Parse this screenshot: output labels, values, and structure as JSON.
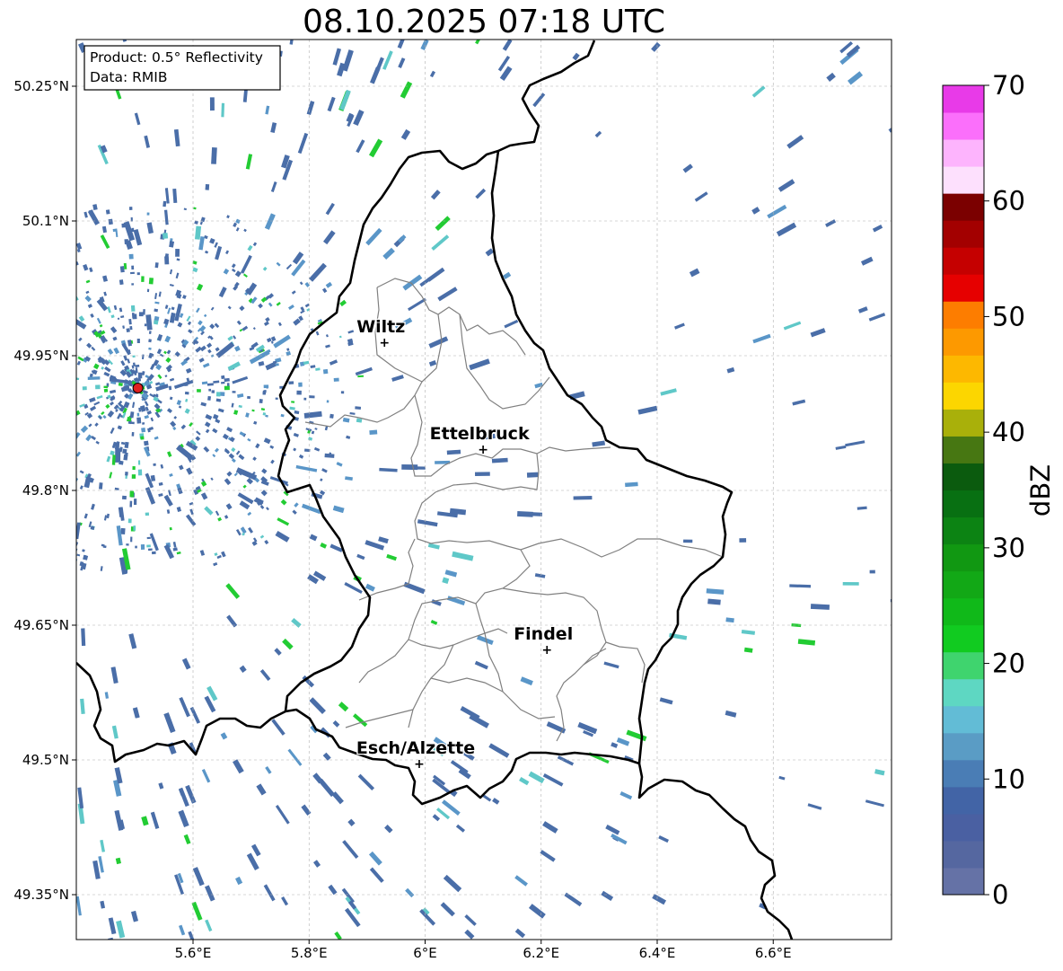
{
  "title": "08.10.2025 07:18 UTC",
  "info_box": {
    "product": "Product: 0.5° Reflectivity",
    "data": "Data: RMIB"
  },
  "axes": {
    "lon_ticks": [
      {
        "value": 5.6,
        "label": "5.6°E"
      },
      {
        "value": 5.8,
        "label": "5.8°E"
      },
      {
        "value": 6.0,
        "label": "6°E"
      },
      {
        "value": 6.2,
        "label": "6.2°E"
      },
      {
        "value": 6.4,
        "label": "6.4°E"
      },
      {
        "value": 6.6,
        "label": "6.6°E"
      }
    ],
    "lat_ticks": [
      {
        "value": 50.25,
        "label": "50.25°N"
      },
      {
        "value": 50.1,
        "label": "50.1°N"
      },
      {
        "value": 49.95,
        "label": "49.95°N"
      },
      {
        "value": 49.8,
        "label": "49.8°N"
      },
      {
        "value": 49.65,
        "label": "49.65°N"
      },
      {
        "value": 49.5,
        "label": "49.5°N"
      },
      {
        "value": 49.35,
        "label": "49.35°N"
      }
    ]
  },
  "places": [
    {
      "name": "Wiltz",
      "lon": 5.93,
      "lat": 49.965
    },
    {
      "name": "Ettelbruck",
      "lon": 6.1,
      "lat": 49.846
    },
    {
      "name": "Findel",
      "lon": 6.21,
      "lat": 49.623
    },
    {
      "name": "Esch/Alzette",
      "lon": 5.99,
      "lat": 49.496
    }
  ],
  "radar_site": {
    "lon": 5.505,
    "lat": 49.914
  },
  "colorbar": {
    "label": "dBZ",
    "ticks": [
      {
        "value": 0,
        "label": "0"
      },
      {
        "value": 10,
        "label": "10"
      },
      {
        "value": 20,
        "label": "20"
      },
      {
        "value": 30,
        "label": "30"
      },
      {
        "value": 40,
        "label": "40"
      },
      {
        "value": 50,
        "label": "50"
      },
      {
        "value": 60,
        "label": "60"
      },
      {
        "value": 70,
        "label": "70"
      }
    ],
    "colors": [
      "#6572a6",
      "#5567a0",
      "#4a60a2",
      "#4264a6",
      "#4a7db5",
      "#5a9cc5",
      "#62bcd6",
      "#5ed7c2",
      "#3fd46e",
      "#11cb20",
      "#10b919",
      "#12a816",
      "#119812",
      "#0c8313",
      "#087012",
      "#0b5b0e",
      "#477712",
      "#a9b00a",
      "#fcd600",
      "#fdb800",
      "#fd9900",
      "#fd7d00",
      "#e60000",
      "#c50000",
      "#a30000",
      "#7b0000",
      "#fde0fd",
      "#fdb4fd",
      "#fb6ffb",
      "#e83ae8"
    ]
  },
  "colors": {
    "weak_echo": "#4a6ea8",
    "light_echo": "#5a96c8",
    "cyan_echo": "#5fc8c8",
    "green_echo": "#22cc33",
    "border": "#000000",
    "canton_border": "#808080",
    "grid": "#b0b0b0",
    "radar_marker": "#e02020"
  }
}
